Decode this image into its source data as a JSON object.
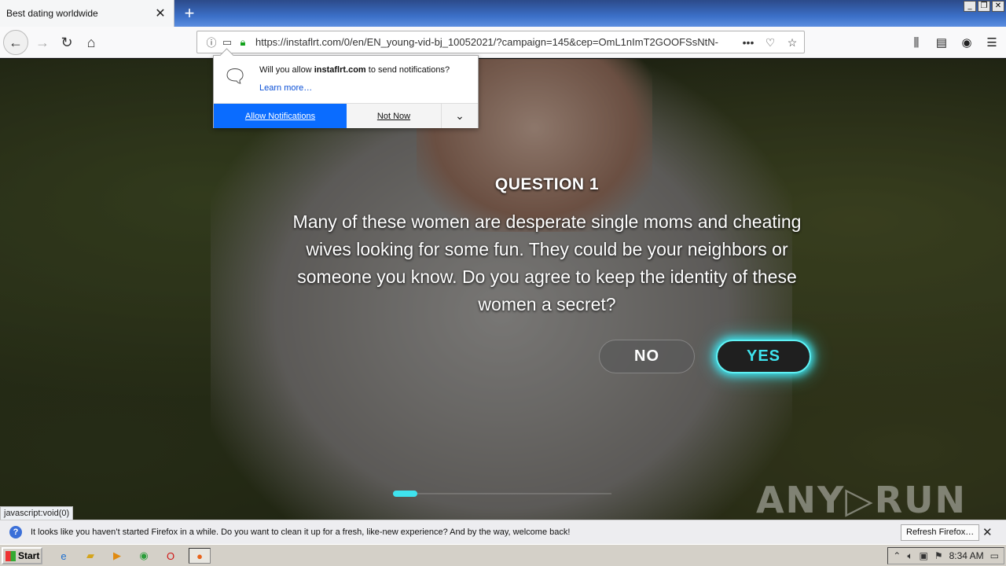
{
  "browser": {
    "tab": {
      "title": "Best dating worldwide",
      "close": "✕"
    },
    "new_tab": "+",
    "window_controls": {
      "minimize": "_",
      "restore": "❐",
      "close": "✕"
    },
    "nav": {
      "back": "←",
      "forward": "→",
      "reload": "↻",
      "home": "⌂"
    },
    "url": "https://instaflrt.com/0/en/EN_young-vid-bj_10052021/?campaign=145&cep=OmL1nImT2GOOFSsNtN-",
    "url_actions": {
      "more": "•••",
      "pocket": "♡",
      "bookmark": "☆"
    },
    "right_tools": {
      "library": "⫼",
      "sidebar": "▤",
      "account": "◉",
      "menu": "☰"
    }
  },
  "notification_prompt": {
    "message_prefix": "Will you allow ",
    "site": "instaflrt.com",
    "message_suffix": " to send notifications?",
    "learn_more": "Learn more…",
    "allow": "Allow Notifications",
    "not_now": "Not Now",
    "more": "⌄"
  },
  "quiz": {
    "title": "QUESTION 1",
    "question": "Many of these women are desperate single moms and cheating wives looking for some fun. They could be your neighbors or someone you know. Do you agree to keep the identity of these women a secret?",
    "no_label": "NO",
    "yes_label": "YES",
    "progress_fraction": 0.11
  },
  "status_link": "javascript:void(0)",
  "watermark": "ANY▷RUN",
  "infobar": {
    "icon": "?",
    "text": "It looks like you haven’t started Firefox in a while. Do you want to clean it up for a fresh, like-new experience? And by the way, welcome back!",
    "button": "Refresh Firefox…",
    "close": "✕"
  },
  "taskbar": {
    "start": "Start",
    "clock": "8:34 AM"
  },
  "colors": {
    "accent_cyan": "#3fe3ee",
    "allow_blue": "#0a6cff"
  }
}
